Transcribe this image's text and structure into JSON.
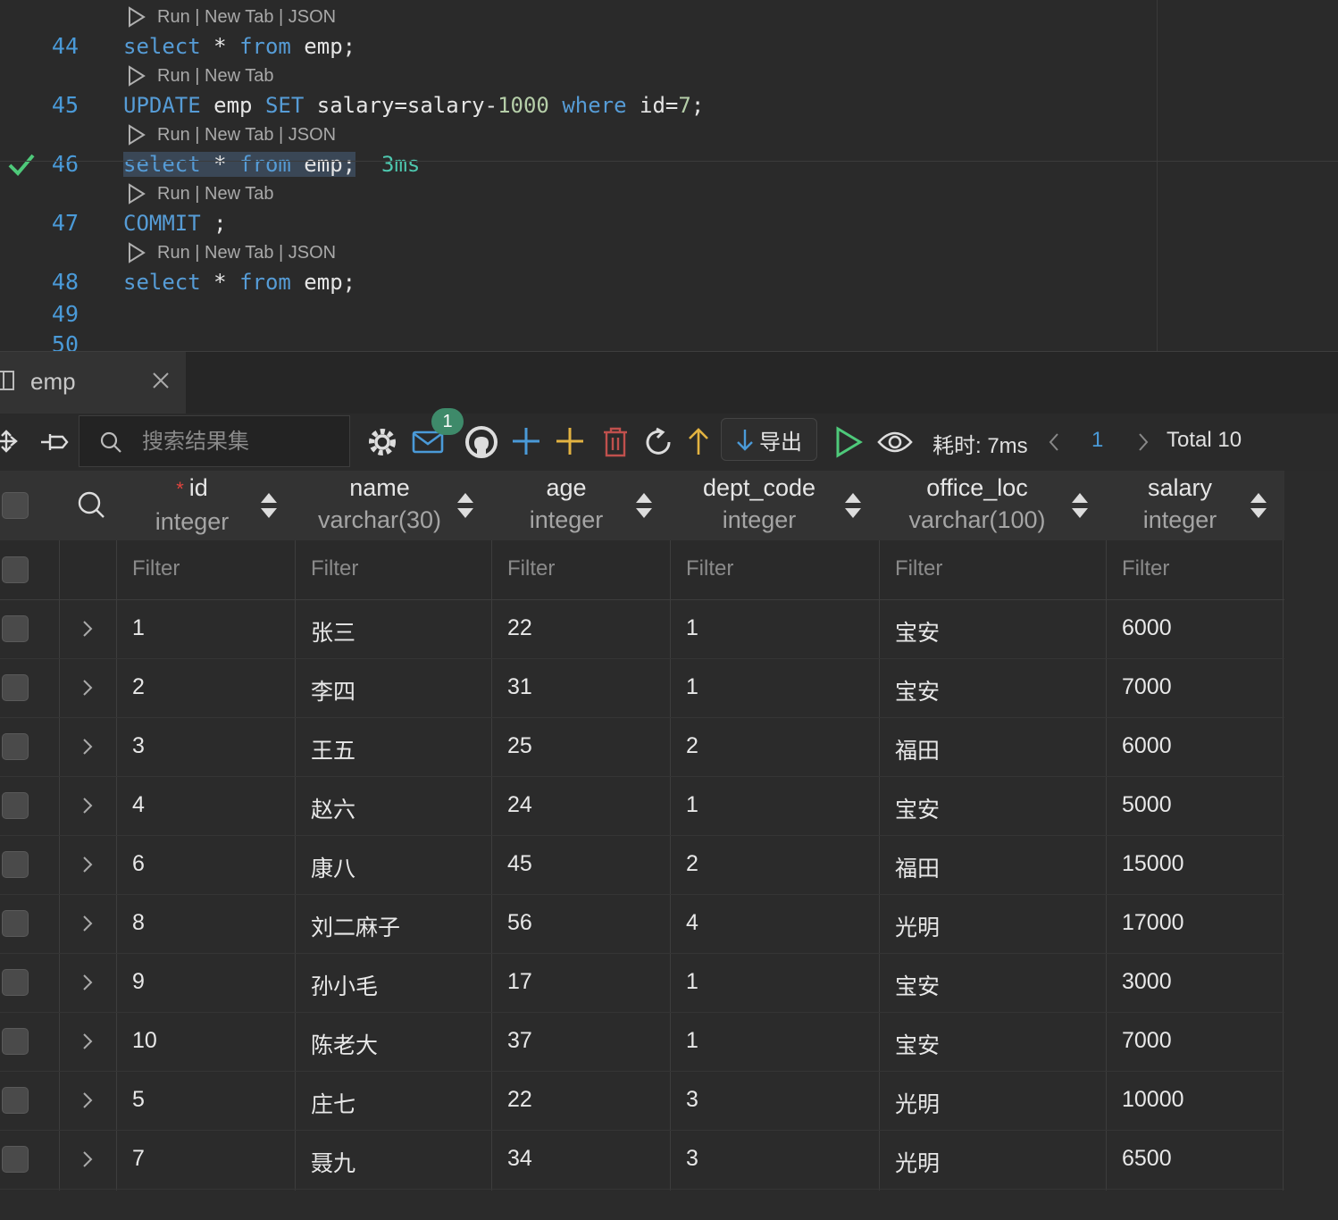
{
  "editor": {
    "lenses": [
      {
        "text": "Run | New Tab | JSON"
      },
      {
        "text": "Run | New Tab"
      },
      {
        "text": "Run | New Tab | JSON"
      },
      {
        "text": "Run | New Tab"
      },
      {
        "text": "Run | New Tab | JSON"
      }
    ],
    "lines": [
      {
        "number": "44"
      },
      {
        "number": "45"
      },
      {
        "number": "46",
        "timing": "3ms"
      },
      {
        "number": "47"
      },
      {
        "number": "48"
      },
      {
        "number": "49"
      },
      {
        "number": "50"
      }
    ],
    "code": {
      "l44": [
        "select",
        " * ",
        "from",
        " emp;"
      ],
      "l45": [
        "UPDATE",
        " emp ",
        "SET",
        " salary=salary-",
        "1000",
        " ",
        "where",
        " id=",
        "7",
        ";"
      ],
      "l46": [
        "select",
        " * ",
        "from",
        " emp;"
      ],
      "l47": [
        "COMMIT",
        " ;"
      ],
      "l48": [
        "select",
        " * ",
        "from",
        " emp;"
      ]
    }
  },
  "result_tab": {
    "label": "emp"
  },
  "toolbar": {
    "search_placeholder": "搜索结果集",
    "notification_count": "1",
    "export_label": "导出",
    "elapsed": "耗时: 7ms",
    "page": "1",
    "total": "Total 10"
  },
  "columns": [
    {
      "name": "id",
      "type": "integer",
      "required": "*"
    },
    {
      "name": "name",
      "type": "varchar(30)"
    },
    {
      "name": "age",
      "type": "integer"
    },
    {
      "name": "dept_code",
      "type": "integer"
    },
    {
      "name": "office_loc",
      "type": "varchar(100)"
    },
    {
      "name": "salary",
      "type": "integer"
    }
  ],
  "filter_placeholder": "Filter",
  "rows": [
    [
      "1",
      "张三",
      "22",
      "1",
      "宝安",
      "6000"
    ],
    [
      "2",
      "李四",
      "31",
      "1",
      "宝安",
      "7000"
    ],
    [
      "3",
      "王五",
      "25",
      "2",
      "福田",
      "6000"
    ],
    [
      "4",
      "赵六",
      "24",
      "1",
      "宝安",
      "5000"
    ],
    [
      "6",
      "康八",
      "45",
      "2",
      "福田",
      "15000"
    ],
    [
      "8",
      "刘二麻子",
      "56",
      "4",
      "光明",
      "17000"
    ],
    [
      "9",
      "孙小毛",
      "17",
      "1",
      "宝安",
      "3000"
    ],
    [
      "10",
      "陈老大",
      "37",
      "1",
      "宝安",
      "7000"
    ],
    [
      "5",
      "庄七",
      "22",
      "3",
      "光明",
      "10000"
    ],
    [
      "7",
      "聂九",
      "34",
      "3",
      "光明",
      "6500"
    ]
  ],
  "colors": {
    "keyword": "#569cd6",
    "number": "#b5cea8",
    "success": "#4ec9b0",
    "accent": "#4a9ad8"
  }
}
